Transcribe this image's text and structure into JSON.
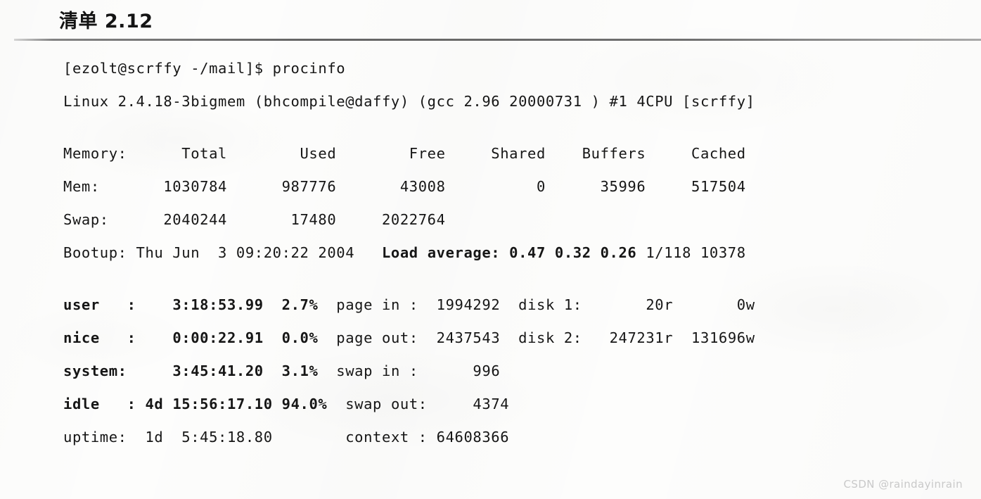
{
  "document": {
    "title": "清单 2.12",
    "watermark": "CSDN @raindayinrain"
  },
  "terminal": {
    "prompt_line": "[ezolt@scrffy -/mail]$ procinfo",
    "kernel_line": "Linux 2.4.18-3bigmem (bhcompile@daffy) (gcc 2.96 20000731 ) #1 4CPU [scrffy]",
    "memory_table": {
      "header": "Memory:      Total        Used        Free     Shared    Buffers     Cached",
      "rows": [
        "Mem:       1030784      987776       43008          0      35996     517504",
        "Swap:      2040244       17480     2022764"
      ]
    },
    "bootup": {
      "label": "Bootup: Thu Jun  3 09:20:22 2004",
      "load_label": "Load average: 0.47 0.32 0.26",
      "load_extra": " 1/118 10378"
    },
    "cpu_rows": [
      {
        "name": "user   :",
        "time": "    3:18:53.99",
        "percent": "  2.7%",
        "io_label": "  page in :",
        "io_value": "  1994292",
        "disk_label": "  disk 1:",
        "disk_read": "       20r",
        "disk_write": "       0w"
      },
      {
        "name": "nice   :",
        "time": "    0:00:22.91",
        "percent": "  0.0%",
        "io_label": "  page out:",
        "io_value": "  2437543",
        "disk_label": "  disk 2:",
        "disk_read": "   247231r",
        "disk_write": "  131696w"
      },
      {
        "name": "system:",
        "time": "     3:45:41.20",
        "percent": "  3.1%",
        "io_label": "  swap in :",
        "io_value": "      996",
        "disk_label": "",
        "disk_read": "",
        "disk_write": ""
      },
      {
        "name": "idle   :",
        "time": " 4d 15:56:17.10",
        "percent": " 94.0%",
        "io_label": "  swap out:",
        "io_value": "     4374",
        "disk_label": "",
        "disk_read": "",
        "disk_write": ""
      }
    ],
    "uptime_row": {
      "name": "uptime:",
      "time": "  1d  5:45:18.80",
      "spacer": "        ",
      "context_label": "context : ",
      "context_value": "64608366"
    }
  }
}
